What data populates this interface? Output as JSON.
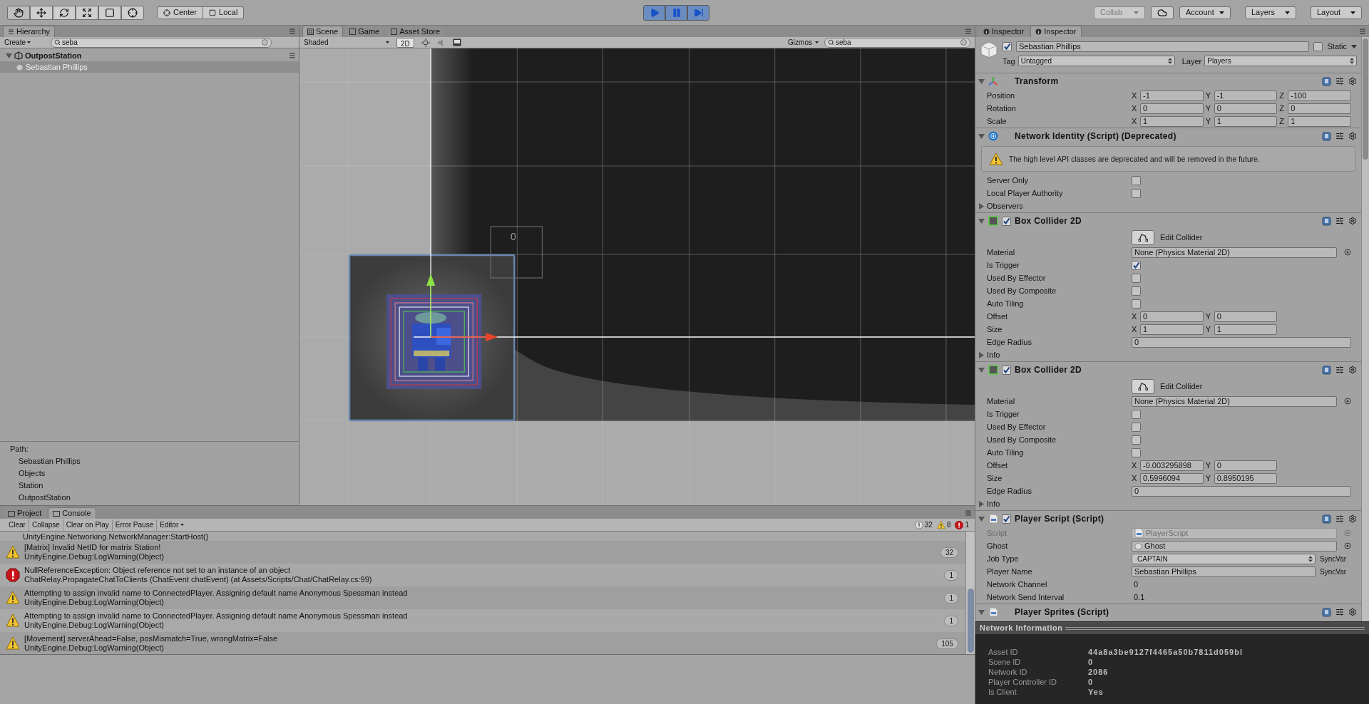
{
  "toolbar": {
    "pivot_buttons": [
      {
        "label": "Center"
      },
      {
        "label": "Local"
      }
    ],
    "play_mode": true,
    "right_items": [
      {
        "kind": "dropdown",
        "label": "Collab",
        "disabled": true
      },
      {
        "kind": "cloud"
      },
      {
        "kind": "dropdown",
        "label": "Account",
        "disabled": false
      },
      {
        "kind": "dropdown",
        "label": "Layers",
        "disabled": false
      },
      {
        "kind": "dropdown",
        "label": "Layout",
        "disabled": false
      }
    ]
  },
  "hierarchy": {
    "tab": "Hierarchy",
    "create": "Create",
    "search": "seba",
    "tree": [
      {
        "label": "OutpostStation",
        "selected": false,
        "expanded": true,
        "children": [
          {
            "label": "Sebastian Phillips",
            "selected": true
          }
        ]
      }
    ],
    "path_title": "Path:",
    "path": [
      "Sebastian Phillips",
      "Objects",
      "Station",
      "OutpostStation"
    ]
  },
  "scene": {
    "tabs": [
      {
        "label": "Scene",
        "selected": true
      },
      {
        "label": "Game",
        "selected": false
      },
      {
        "label": "Asset Store",
        "selected": false
      }
    ],
    "shading": "Shaded",
    "mode_2d": {
      "label": "2D",
      "on": true
    },
    "gizmos": "Gizmos",
    "search": "seba",
    "label": "0"
  },
  "console": {
    "tabs": [
      {
        "label": "Project",
        "selected": false
      },
      {
        "label": "Console",
        "selected": true
      }
    ],
    "buttons": [
      "Clear",
      "Collapse",
      "Clear on Play",
      "Error Pause"
    ],
    "editor": "Editor",
    "counts": [
      {
        "kind": "info",
        "value": "32"
      },
      {
        "kind": "warning",
        "value": "8"
      },
      {
        "kind": "error",
        "value": "1"
      }
    ],
    "cut_line": "UnityEngine.Networking.NetworkManager:StartHost()",
    "entries": [
      {
        "kind": "warning",
        "lines": [
          "[Matrix] Invalid NetID for matrix Station!",
          "UnityEngine.Debug:LogWarning(Object)"
        ],
        "count": "32"
      },
      {
        "kind": "error",
        "lines": [
          "NullReferenceException: Object reference not set to an instance of an object",
          "ChatRelay.PropagateChatToClients (ChatEvent chatEvent) (at Assets/Scripts/Chat/ChatRelay.cs:99)"
        ],
        "count": "1"
      },
      {
        "kind": "warning",
        "lines": [
          "Attempting to assign invalid name to ConnectedPlayer. Assigning default name Anonymous Spessman instead",
          "UnityEngine.Debug:LogWarning(Object)"
        ],
        "count": "1"
      },
      {
        "kind": "warning",
        "lines": [
          "Attempting to assign invalid name to ConnectedPlayer. Assigning default name Anonymous Spessman instead",
          "UnityEngine.Debug:LogWarning(Object)"
        ],
        "count": "1"
      },
      {
        "kind": "warning",
        "lines": [
          "[Movement] serverAhead=False, posMismatch=True, wrongMatrix=False",
          "UnityEngine.Debug:LogWarning(Object)"
        ],
        "count": "105"
      }
    ]
  },
  "inspector": {
    "tabs": [
      {
        "label": "Inspector",
        "selected": false
      },
      {
        "label": "Inspector",
        "selected": true
      }
    ],
    "object": {
      "active": true,
      "name": "Sebastian Phillips",
      "static_label": "Static",
      "static": false,
      "tag_label": "Tag",
      "tag": "Untagged",
      "layer_label": "Layer",
      "layer": "Players"
    },
    "components": [
      {
        "kind": "transform",
        "title": "Transform",
        "expanded": true,
        "fields": [
          {
            "kind": "vector",
            "label": "Position",
            "axes": [
              {
                "axis": "X",
                "value": "-1"
              },
              {
                "axis": "Y",
                "value": "-1"
              },
              {
                "axis": "Z",
                "value": "-100"
              }
            ]
          },
          {
            "kind": "vector",
            "label": "Rotation",
            "axes": [
              {
                "axis": "X",
                "value": "0"
              },
              {
                "axis": "Y",
                "value": "0"
              },
              {
                "axis": "Z",
                "value": "0"
              }
            ]
          },
          {
            "kind": "vector",
            "label": "Scale",
            "axes": [
              {
                "axis": "X",
                "value": "1"
              },
              {
                "axis": "Y",
                "value": "1"
              },
              {
                "axis": "Z",
                "value": "1"
              }
            ]
          }
        ]
      },
      {
        "kind": "network",
        "title": "Network Identity (Script) (Deprecated)",
        "expanded": true,
        "fields": [
          {
            "kind": "helpbox",
            "text": "The high level API classes are deprecated and will be removed in the future."
          },
          {
            "kind": "checkbox",
            "label": "Server Only",
            "checked": false
          },
          {
            "kind": "checkbox",
            "label": "Local Player Authority",
            "checked": false
          },
          {
            "kind": "foldout",
            "label": "Observers",
            "expanded": false
          }
        ]
      },
      {
        "kind": "collider",
        "title": "Box Collider 2D",
        "enabled": true,
        "expanded": true,
        "fields": [
          {
            "kind": "edit_button",
            "label": "Edit Collider"
          },
          {
            "kind": "object",
            "label": "Material",
            "value": "None (Physics Material 2D)",
            "disabled": false
          },
          {
            "kind": "checkbox",
            "label": "Is Trigger",
            "checked": true
          },
          {
            "kind": "checkbox",
            "label": "Used By Effector",
            "checked": false
          },
          {
            "kind": "checkbox",
            "label": "Used By Composite",
            "checked": false
          },
          {
            "kind": "checkbox",
            "label": "Auto Tiling",
            "checked": false
          },
          {
            "kind": "vector",
            "label": "Offset",
            "axes": [
              {
                "axis": "X",
                "value": "0"
              },
              {
                "axis": "Y",
                "value": "0"
              }
            ]
          },
          {
            "kind": "vector",
            "label": "Size",
            "axes": [
              {
                "axis": "X",
                "value": "1"
              },
              {
                "axis": "Y",
                "value": "1"
              }
            ]
          },
          {
            "kind": "text",
            "label": "Edge Radius",
            "value": "0"
          },
          {
            "kind": "foldout",
            "label": "Info",
            "expanded": false
          }
        ]
      },
      {
        "kind": "collider",
        "title": "Box Collider 2D",
        "enabled": true,
        "expanded": true,
        "fields": [
          {
            "kind": "edit_button",
            "label": "Edit Collider"
          },
          {
            "kind": "object",
            "label": "Material",
            "value": "None (Physics Material 2D)",
            "disabled": false
          },
          {
            "kind": "checkbox",
            "label": "Is Trigger",
            "checked": false
          },
          {
            "kind": "checkbox",
            "label": "Used By Effector",
            "checked": false
          },
          {
            "kind": "checkbox",
            "label": "Used By Composite",
            "checked": false
          },
          {
            "kind": "checkbox",
            "label": "Auto Tiling",
            "checked": false
          },
          {
            "kind": "vector",
            "label": "Offset",
            "axes": [
              {
                "axis": "X",
                "value": "-0.003295898"
              },
              {
                "axis": "Y",
                "value": "0"
              }
            ]
          },
          {
            "kind": "vector",
            "label": "Size",
            "axes": [
              {
                "axis": "X",
                "value": "0.5996094"
              },
              {
                "axis": "Y",
                "value": "0.8950195"
              }
            ]
          },
          {
            "kind": "text",
            "label": "Edge Radius",
            "value": "0"
          },
          {
            "kind": "foldout",
            "label": "Info",
            "expanded": false
          }
        ]
      },
      {
        "kind": "script",
        "title": "Player Script (Script)",
        "enabled": true,
        "expanded": true,
        "fields": [
          {
            "kind": "script_object",
            "label": "Script",
            "value": "PlayerScript",
            "disabled": true
          },
          {
            "kind": "prefab_object",
            "label": "Ghost",
            "value": "Ghost",
            "disabled": false
          },
          {
            "kind": "dropdown",
            "label": "Job Type",
            "value": "CAPTAIN",
            "suffix": "SyncVar"
          },
          {
            "kind": "text",
            "label": "Player Name",
            "value": "Sebastian Phillips",
            "suffix": "SyncVar"
          },
          {
            "kind": "value",
            "label": "Network Channel",
            "value": "0"
          },
          {
            "kind": "value",
            "label": "Network Send Interval",
            "value": "0.1"
          }
        ]
      },
      {
        "kind": "script",
        "title": "Player Sprites (Script)",
        "expanded": true
      }
    ]
  },
  "network_info": {
    "title": "Network Information",
    "rows": [
      {
        "label": "Asset ID",
        "value": "44a8a3be9127f4465a50b7811d059bl"
      },
      {
        "label": "Scene ID",
        "value": "0"
      },
      {
        "label": "Network ID",
        "value": "2086"
      },
      {
        "label": "Player Controller ID",
        "value": "0"
      },
      {
        "label": "Is Client",
        "value": "Yes"
      }
    ]
  }
}
